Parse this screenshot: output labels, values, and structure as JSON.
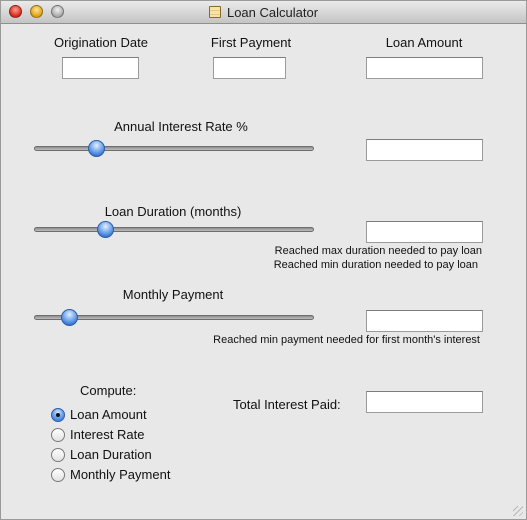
{
  "window": {
    "title": "Loan Calculator",
    "buttons": {
      "close": "close-button",
      "minimize": "minimize-button",
      "zoom": "zoom-button"
    }
  },
  "top_fields": {
    "origination_date": {
      "label": "Origination Date",
      "value": ""
    },
    "first_payment": {
      "label": "First Payment",
      "value": ""
    },
    "loan_amount": {
      "label": "Loan Amount",
      "value": ""
    }
  },
  "interest": {
    "label": "Annual Interest Rate %",
    "value": "",
    "slider_position": 0.22
  },
  "duration": {
    "label": "Loan Duration (months)",
    "value": "",
    "slider_position": 0.255,
    "note_max": "Reached max duration needed to pay loan",
    "note_min": "Reached min duration needed to pay loan"
  },
  "payment": {
    "label": "Monthly Payment",
    "value": "",
    "slider_position": 0.125,
    "note_min": "Reached min payment needed for first month's interest"
  },
  "compute": {
    "label": "Compute:",
    "selected": "Loan Amount",
    "options": [
      "Loan Amount",
      "Interest Rate",
      "Loan Duration",
      "Monthly Payment"
    ]
  },
  "total_interest": {
    "label": "Total Interest Paid:",
    "value": ""
  },
  "colors": {
    "window_bg": "#e8e8e8",
    "slider_thumb": "#3d7ad6"
  }
}
